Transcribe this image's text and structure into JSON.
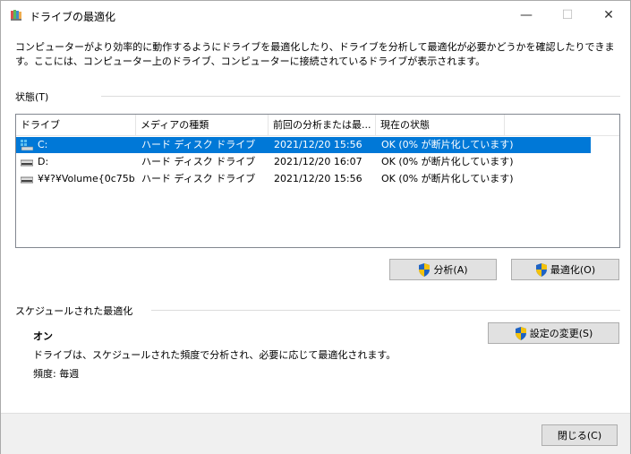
{
  "window": {
    "title": "ドライブの最適化",
    "minimize_glyph": "—",
    "maximize_glyph": "☐",
    "close_glyph": "✕"
  },
  "description": "コンピューターがより効率的に動作するようにドライブを最適化したり、ドライブを分析して最適化が必要かどうかを確認したりできます。ここには、コンピューター上のドライブ、コンピューターに接続されているドライブが表示されます。",
  "status": {
    "label": "状態(T)",
    "columns": [
      "ドライブ",
      "メディアの種類",
      "前回の分析または最...",
      "現在の状態"
    ],
    "rows": [
      {
        "drive": "C:",
        "media": "ハード ディスク ドライブ",
        "last": "2021/12/20 15:56",
        "state": "OK (0% が断片化しています)",
        "selected": true
      },
      {
        "drive": "D:",
        "media": "ハード ディスク ドライブ",
        "last": "2021/12/20 16:07",
        "state": "OK (0% が断片化しています)",
        "selected": false
      },
      {
        "drive": "¥¥?¥Volume{0c75b...",
        "media": "ハード ディスク ドライブ",
        "last": "2021/12/20 15:56",
        "state": "OK (0% が断片化しています)",
        "selected": false
      }
    ]
  },
  "buttons": {
    "analyze": "分析(A)",
    "optimize": "最適化(O)",
    "change_settings": "設定の変更(S)",
    "close": "閉じる(C)"
  },
  "schedule": {
    "title": "スケジュールされた最適化",
    "state": "オン",
    "description": "ドライブは、スケジュールされた頻度で分析され、必要に応じて最適化されます。",
    "frequency": "頻度: 毎週"
  },
  "colors": {
    "selection": "#0078d7",
    "button_face": "#e1e1e1",
    "footer": "#f0f0f0"
  }
}
